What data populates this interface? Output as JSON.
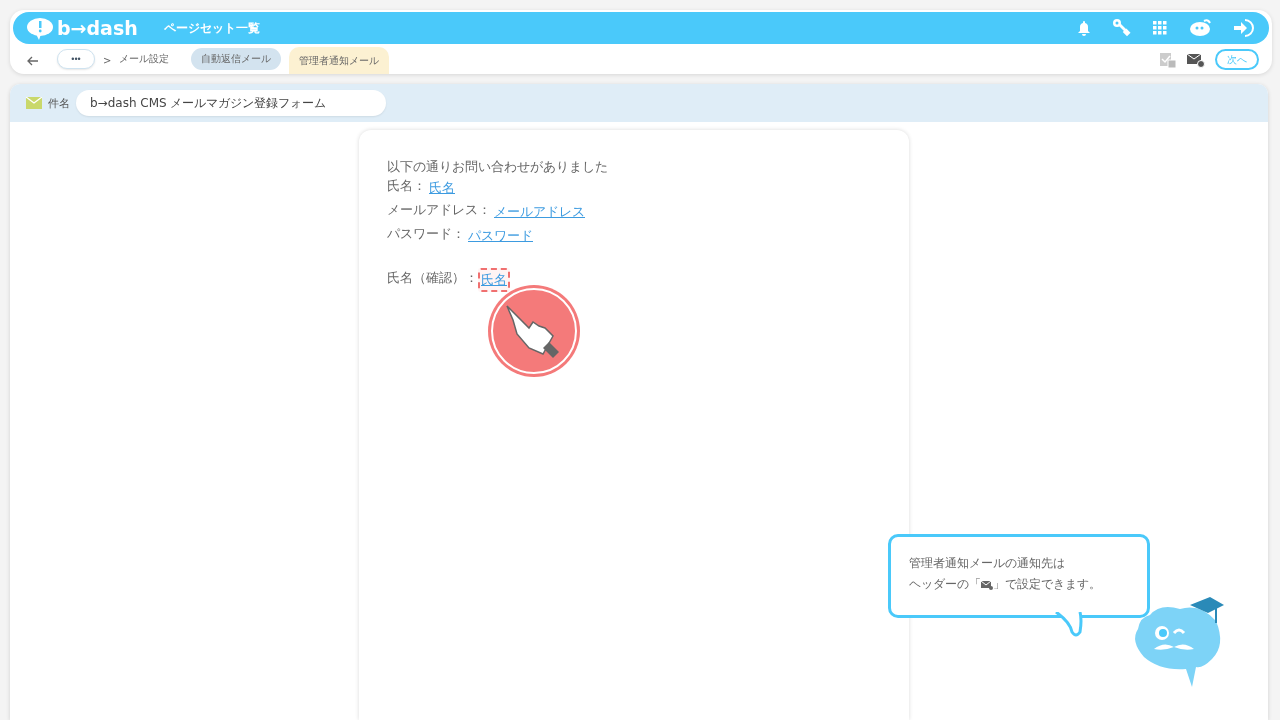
{
  "header": {
    "logo": "b→dash",
    "title": "ページセット一覧"
  },
  "breadcrumb": {
    "more": "•••",
    "separator": ">",
    "current": "メール設定"
  },
  "tabs": [
    {
      "label": "自動返信メール",
      "selected": false
    },
    {
      "label": "管理者通知メール",
      "selected": true
    }
  ],
  "next_button": "次へ",
  "subject": {
    "label": "件名",
    "value": "b→dash CMS メールマガジン登録フォーム"
  },
  "email_body": {
    "intro": "以下の通りお問い合わせがありました",
    "fields": [
      {
        "label": "氏名：",
        "link": "氏名",
        "highlighted": false
      },
      {
        "label": "メールアドレス：",
        "link": "メールアドレス",
        "highlighted": false
      },
      {
        "label": "パスワード：",
        "link": "パスワード",
        "highlighted": false
      },
      {
        "label": "氏名（確認）：",
        "link": "氏名",
        "highlighted": true,
        "gap_before": true
      }
    ]
  },
  "tooltip": {
    "line_1": "管理者通知メールの通知先は",
    "line_2_before": "ヘッダーの「",
    "line_2_after": "」で設定できます。"
  }
}
